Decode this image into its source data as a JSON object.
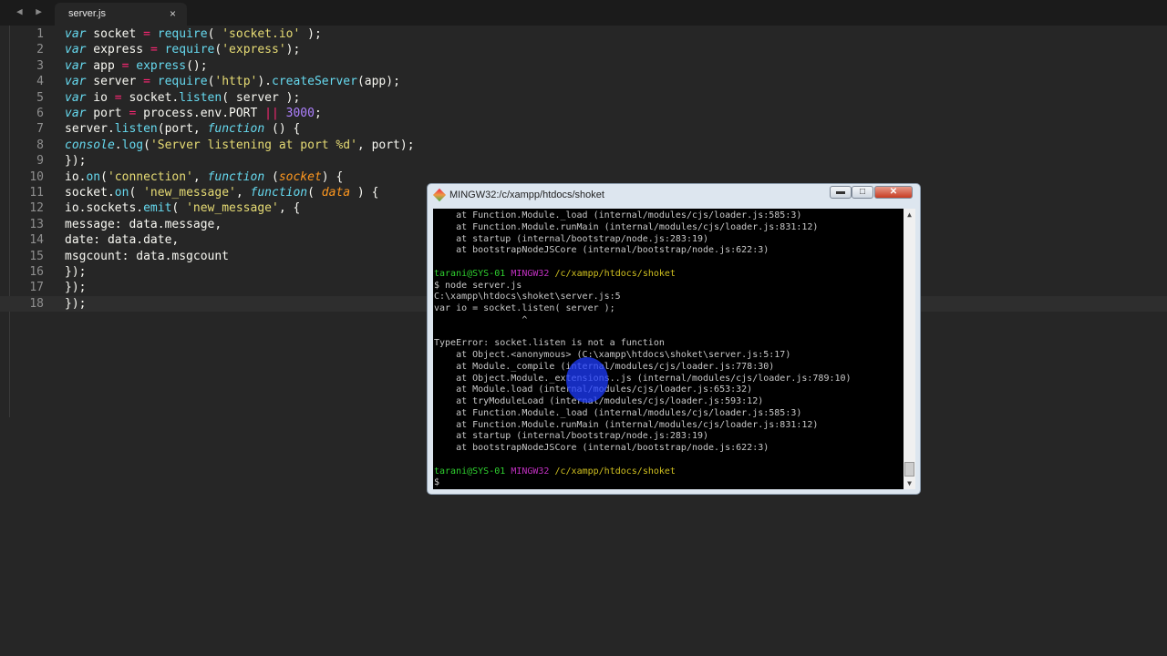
{
  "tabs": [
    {
      "label": "server.js",
      "close": "×"
    }
  ],
  "nav_arrows": "◀ ▶",
  "editor": {
    "active_line": 18,
    "lines": [
      [
        {
          "t": "var",
          "c": "kw"
        },
        {
          "t": " socket "
        },
        {
          "t": "=",
          "c": "op"
        },
        {
          "t": " "
        },
        {
          "t": "require",
          "c": "fn"
        },
        {
          "t": "( "
        },
        {
          "t": "'socket.io'",
          "c": "str"
        },
        {
          "t": " );"
        }
      ],
      [
        {
          "t": "var",
          "c": "kw"
        },
        {
          "t": " express "
        },
        {
          "t": "=",
          "c": "op"
        },
        {
          "t": " "
        },
        {
          "t": "require",
          "c": "fn"
        },
        {
          "t": "("
        },
        {
          "t": "'express'",
          "c": "str"
        },
        {
          "t": ");"
        }
      ],
      [
        {
          "t": "var",
          "c": "kw"
        },
        {
          "t": " app "
        },
        {
          "t": "=",
          "c": "op"
        },
        {
          "t": " "
        },
        {
          "t": "express",
          "c": "fn"
        },
        {
          "t": "();"
        }
      ],
      [
        {
          "t": "var",
          "c": "kw"
        },
        {
          "t": " server "
        },
        {
          "t": "=",
          "c": "op"
        },
        {
          "t": " "
        },
        {
          "t": "require",
          "c": "fn"
        },
        {
          "t": "("
        },
        {
          "t": "'http'",
          "c": "str"
        },
        {
          "t": ")."
        },
        {
          "t": "createServer",
          "c": "fn"
        },
        {
          "t": "(app);"
        }
      ],
      [
        {
          "t": "var",
          "c": "kw"
        },
        {
          "t": " io "
        },
        {
          "t": "=",
          "c": "op"
        },
        {
          "t": " socket."
        },
        {
          "t": "listen",
          "c": "fn"
        },
        {
          "t": "( server );"
        }
      ],
      [
        {
          "t": "var",
          "c": "kw"
        },
        {
          "t": " port "
        },
        {
          "t": "=",
          "c": "op"
        },
        {
          "t": " process.env.PORT "
        },
        {
          "t": "||",
          "c": "op"
        },
        {
          "t": " "
        },
        {
          "t": "3000",
          "c": "num"
        },
        {
          "t": ";"
        }
      ],
      [
        {
          "t": "server."
        },
        {
          "t": "listen",
          "c": "fn"
        },
        {
          "t": "(port, "
        },
        {
          "t": "function",
          "c": "kw"
        },
        {
          "t": " () {"
        }
      ],
      [
        {
          "t": "console",
          "c": "kw"
        },
        {
          "t": "."
        },
        {
          "t": "log",
          "c": "fn"
        },
        {
          "t": "("
        },
        {
          "t": "'Server listening at port %d'",
          "c": "str"
        },
        {
          "t": ", port);"
        }
      ],
      [
        {
          "t": "});"
        }
      ],
      [
        {
          "t": "io."
        },
        {
          "t": "on",
          "c": "fn"
        },
        {
          "t": "("
        },
        {
          "t": "'connection'",
          "c": "str"
        },
        {
          "t": ", "
        },
        {
          "t": "function",
          "c": "kw"
        },
        {
          "t": " ("
        },
        {
          "t": "socket",
          "c": "param"
        },
        {
          "t": ") {"
        }
      ],
      [
        {
          "t": "socket."
        },
        {
          "t": "on",
          "c": "fn"
        },
        {
          "t": "( "
        },
        {
          "t": "'new_message'",
          "c": "str"
        },
        {
          "t": ", "
        },
        {
          "t": "function",
          "c": "kw"
        },
        {
          "t": "( "
        },
        {
          "t": "data",
          "c": "param"
        },
        {
          "t": " ) {"
        }
      ],
      [
        {
          "t": "io.sockets."
        },
        {
          "t": "emit",
          "c": "fn"
        },
        {
          "t": "( "
        },
        {
          "t": "'new_message'",
          "c": "str"
        },
        {
          "t": ", {"
        }
      ],
      [
        {
          "t": "message: data.message,"
        }
      ],
      [
        {
          "t": "date: data.date,"
        }
      ],
      [
        {
          "t": "msgcount: data.msgcount"
        }
      ],
      [
        {
          "t": "});"
        }
      ],
      [
        {
          "t": "});"
        }
      ],
      [
        {
          "t": "});"
        }
      ]
    ]
  },
  "terminal": {
    "title": "MINGW32:/c/xampp/htdocs/shoket",
    "buttons": {
      "minimize": "▬",
      "maximize": "□",
      "close": "✕"
    },
    "lines": [
      [
        {
          "t": "    at Function.Module._load (internal/modules/cjs/loader.js:585:3)"
        }
      ],
      [
        {
          "t": "    at Function.Module.runMain (internal/modules/cjs/loader.js:831:12)"
        }
      ],
      [
        {
          "t": "    at startup (internal/bootstrap/node.js:283:19)"
        }
      ],
      [
        {
          "t": "    at bootstrapNodeJSCore (internal/bootstrap/node.js:622:3)"
        }
      ],
      [
        {
          "t": ""
        }
      ],
      [
        {
          "t": "tarani@SYS-01",
          "c": "green"
        },
        {
          "t": " "
        },
        {
          "t": "MINGW32",
          "c": "magenta"
        },
        {
          "t": " "
        },
        {
          "t": "/c/xampp/htdocs/shoket",
          "c": "yellow"
        }
      ],
      [
        {
          "t": "$ node server.js"
        }
      ],
      [
        {
          "t": "C:\\xampp\\htdocs\\shoket\\server.js:5"
        }
      ],
      [
        {
          "t": "var io = socket.listen( server );"
        }
      ],
      [
        {
          "t": "                ^"
        }
      ],
      [
        {
          "t": ""
        }
      ],
      [
        {
          "t": "TypeError: socket.listen is not a function"
        }
      ],
      [
        {
          "t": "    at Object.<anonymous> (C:\\xampp\\htdocs\\shoket\\server.js:5:17)"
        }
      ],
      [
        {
          "t": "    at Module._compile (internal/modules/cjs/loader.js:778:30)"
        }
      ],
      [
        {
          "t": "    at Object.Module._extensions..js (internal/modules/cjs/loader.js:789:10)"
        }
      ],
      [
        {
          "t": "    at Module.load (internal/modules/cjs/loader.js:653:32)"
        }
      ],
      [
        {
          "t": "    at tryModuleLoad (internal/modules/cjs/loader.js:593:12)"
        }
      ],
      [
        {
          "t": "    at Function.Module._load (internal/modules/cjs/loader.js:585:3)"
        }
      ],
      [
        {
          "t": "    at Function.Module.runMain (internal/modules/cjs/loader.js:831:12)"
        }
      ],
      [
        {
          "t": "    at startup (internal/bootstrap/node.js:283:19)"
        }
      ],
      [
        {
          "t": "    at bootstrapNodeJSCore (internal/bootstrap/node.js:622:3)"
        }
      ],
      [
        {
          "t": ""
        }
      ],
      [
        {
          "t": "tarani@SYS-01",
          "c": "green"
        },
        {
          "t": " "
        },
        {
          "t": "MINGW32",
          "c": "magenta"
        },
        {
          "t": " "
        },
        {
          "t": "/c/xampp/htdocs/shoket",
          "c": "yellow"
        }
      ],
      [
        {
          "t": "$"
        }
      ]
    ]
  },
  "colors": {
    "editor_bg": "#262626",
    "keyword": "#66d9ef",
    "string": "#e6db74",
    "operator": "#f92672",
    "number": "#ae81ff",
    "param": "#fd971f",
    "prompt_user": "#2fd02f",
    "prompt_host": "#c030c0",
    "prompt_path": "#d0c020"
  }
}
